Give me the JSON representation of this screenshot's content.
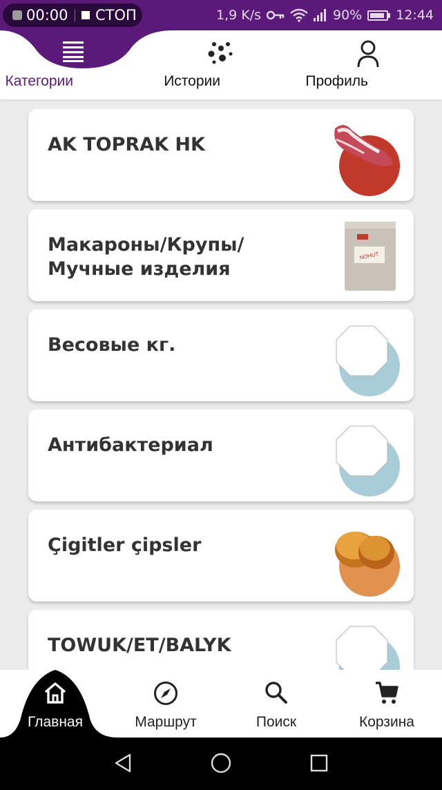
{
  "status_bar": {
    "record_time": "00:00",
    "record_stop": "СТОП",
    "net_speed": "1,9 K/s",
    "battery": "90%",
    "clock": "12:44",
    "icons": [
      "key-icon",
      "wifi-icon",
      "signal-icon",
      "battery-icon"
    ]
  },
  "top_tabs": [
    {
      "label": "Категории",
      "icon": "menu-lines-icon",
      "active": true
    },
    {
      "label": "Истории",
      "icon": "dots-cluster-icon",
      "active": false
    },
    {
      "label": "Профиль",
      "icon": "person-icon",
      "active": false
    }
  ],
  "categories": [
    {
      "title": "AK TOPRAK HK",
      "image": "meat-leg-image"
    },
    {
      "title": "Макароны/Крупы/\nМучные изделия",
      "image": "grain-bag-image"
    },
    {
      "title": "Весовые  кг.",
      "image": "placeholder-image"
    },
    {
      "title": "Антибактериал",
      "image": "placeholder-image"
    },
    {
      "title": "Çigitler çipsler",
      "image": "buns-image"
    },
    {
      "title": "TOWUK/ET/BALYK",
      "image": "placeholder-image"
    }
  ],
  "bottom_nav": [
    {
      "label": "Главная",
      "icon": "home-icon",
      "active": true
    },
    {
      "label": "Маршрут",
      "icon": "compass-icon",
      "active": false
    },
    {
      "label": "Поиск",
      "icon": "search-icon",
      "active": false
    },
    {
      "label": "Корзина",
      "icon": "cart-icon",
      "active": false
    }
  ],
  "colors": {
    "accent": "#5b1a7a",
    "nav_active_bg": "#000000",
    "card_circle_meat": "#c0392b",
    "card_circle_placeholder": "#a9ccd9",
    "card_circle_buns": "#e0924e"
  }
}
